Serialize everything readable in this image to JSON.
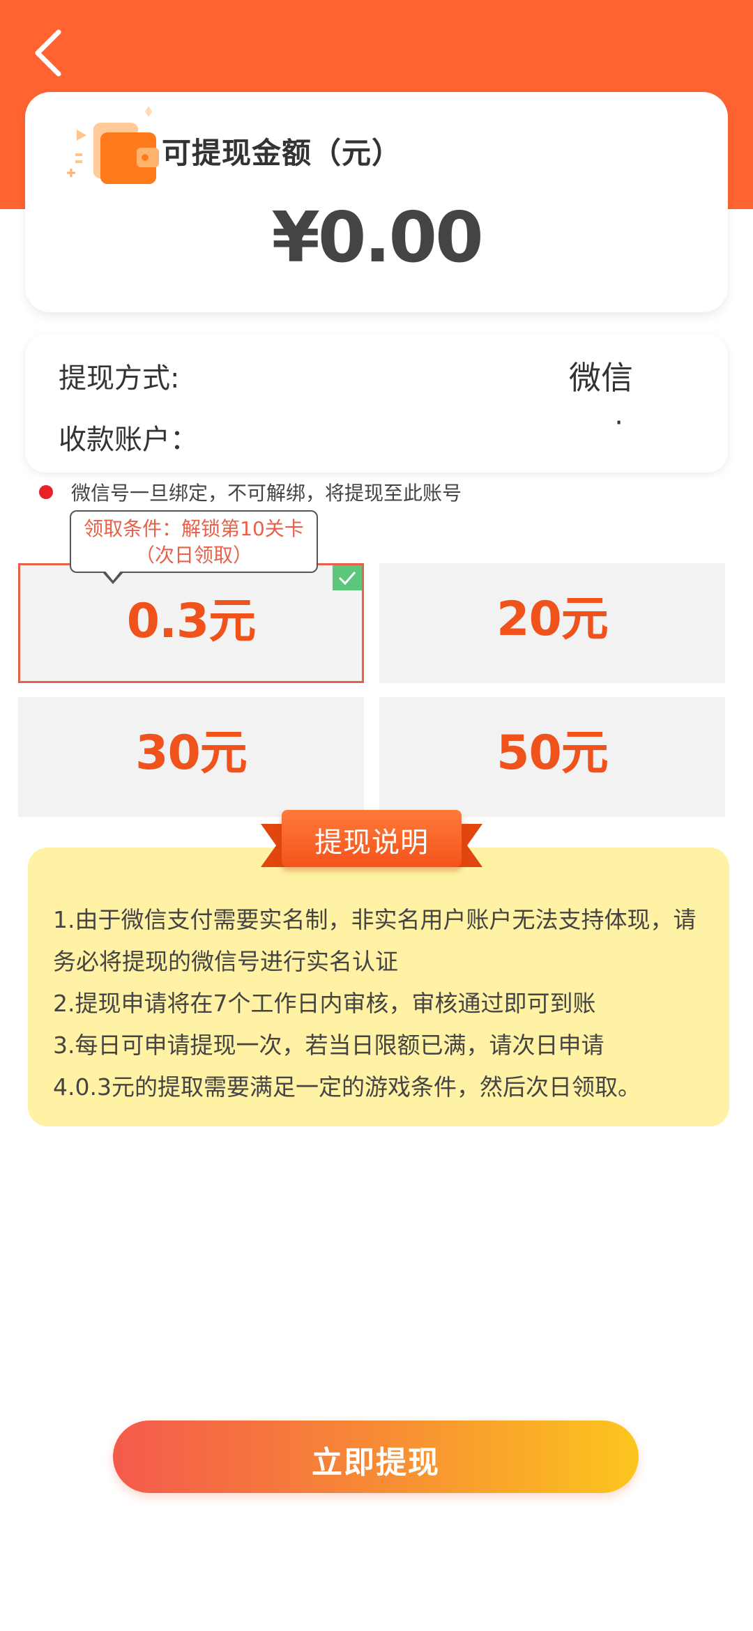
{
  "header": {
    "back_icon": "chevron-left-icon",
    "brand_color": "#FF6332"
  },
  "balance": {
    "icon": "wallet-icon",
    "label": "可提现金额（元）",
    "amount": "¥0.00"
  },
  "withdraw_info": {
    "method_label": "提现方式:",
    "method_value": "微信",
    "account_label": "收款账户：",
    "account_value": "·"
  },
  "notice": {
    "text": "微信号一旦绑定，不可解绑，将提现至此账号",
    "dot_color": "#E8202A"
  },
  "tiers": [
    {
      "amount": "0.3元",
      "selected": true
    },
    {
      "amount": "20元",
      "selected": false
    },
    {
      "amount": "30元",
      "selected": false
    },
    {
      "amount": "50元",
      "selected": false
    }
  ],
  "tooltip": {
    "line1": "领取条件：解锁第10关卡",
    "line2": "（次日领取）"
  },
  "rules": {
    "title": "提现说明",
    "items": [
      "1.由于微信支付需要实名制，非实名用户账户无法支持体现，请务必将提现的微信号进行实名认证",
      "2.提现申请将在7个工作日内审核，审核通过即可到账",
      "3.每日可申请提现一次，若当日限额已满，请次日申请",
      "4.0.3元的提取需要满足一定的游戏条件，然后次日领取。"
    ]
  },
  "submit": {
    "label": "立即提现"
  }
}
